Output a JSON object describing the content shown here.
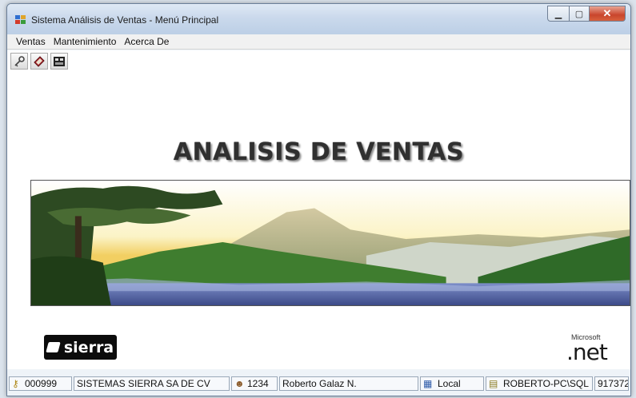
{
  "window": {
    "title": "Sistema Análisis de Ventas - Menú Principal",
    "buttons": {
      "minimize": "▁",
      "maximize": "▢",
      "close": "✕"
    }
  },
  "menu": {
    "items": [
      "Ventas",
      "Mantenimiento",
      "Acerca De"
    ]
  },
  "toolbar": {
    "buttons": [
      {
        "icon": "key-icon"
      },
      {
        "icon": "book-icon"
      },
      {
        "icon": "calculator-icon"
      }
    ]
  },
  "main": {
    "heading": "ANALISIS DE VENTAS",
    "banner_icon": "landscape-image",
    "logo_left": "sierra",
    "logo_right_small": "Microsoft",
    "logo_right": ".net"
  },
  "statusbar": {
    "company_code": "000999",
    "company_name": "SISTEMAS SIERRA SA DE CV",
    "user_code": "1234",
    "user_name": "Roberto Galaz N.",
    "location": "Local",
    "server": "ROBERTO-PC\\SQL",
    "extra": "917372"
  },
  "colors": {
    "titlebar": "#c9d8ea",
    "close_button": "#c9452c",
    "heading_text": "#303030"
  }
}
